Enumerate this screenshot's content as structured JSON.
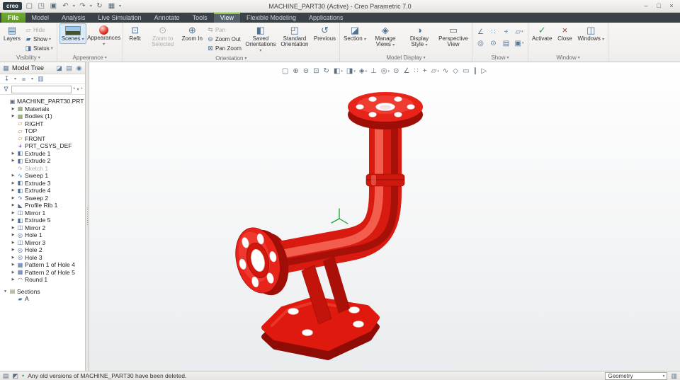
{
  "window": {
    "brand": "creo",
    "title": "MACHINE_PART30 (Active) - Creo Parametric 7.0"
  },
  "colors": {
    "model_red": "#e0190f",
    "model_red_dark": "#8f0c06",
    "tab_bar": "#3a4147",
    "file_tab_green": "#639c30",
    "scenes_selected_blue": "#d9eafb"
  },
  "icons": {
    "chevron_down": "▾",
    "minimize": "–",
    "maximize": "□",
    "close": "×",
    "new_file": "▢",
    "open_file": "◳",
    "save": "▣",
    "undo": "↶",
    "redo": "↷",
    "regenerate": "↻",
    "screen": "▦",
    "qa_more": "▾",
    "layers": "▤",
    "hide": "▱",
    "show": "▰",
    "status": "◨",
    "refit": "⊡",
    "zoom_to_selected": "⊙",
    "zoom_in": "⊕",
    "pan": "⇆",
    "zoom_out": "⊖",
    "pan_zoom": "⊠",
    "saved_orientations": "◧",
    "standard_orientation": "◰",
    "previous": "↺",
    "section": "◪",
    "manage_views": "◈",
    "display_style": "◑",
    "perspective_view": "▭",
    "activate": "✓",
    "close_window": "×",
    "windows": "◫",
    "model_tree": "▦",
    "tree_folders": "◪",
    "tree_save": "▤",
    "info": "◉",
    "tree_filter": "↧",
    "tree_settings": "≡",
    "tree_columns": "▥",
    "search_funnel": "∇",
    "search_clear": "×",
    "search_options": "▾",
    "search_add": "+",
    "msg_log": "▤",
    "msg_flag": "◩",
    "mouse_hint": "▥",
    "bullet": "•"
  },
  "ribbon": {
    "tabs": [
      "File",
      "Model",
      "Analysis",
      "Live Simulation",
      "Annotate",
      "Tools",
      "View",
      "Flexible Modeling",
      "Applications"
    ],
    "active_tab": "View",
    "visibility": {
      "label": "Visibility",
      "layers": "Layers",
      "hide": "Hide",
      "show": "Show",
      "status": "Status"
    },
    "appearance": {
      "label": "Appearance",
      "scenes": "Scenes",
      "appearances": "Appearances"
    },
    "orientation": {
      "label": "Orientation",
      "refit": "Refit",
      "zoom_to_selected": "Zoom to Selected",
      "zoom_in": "Zoom In",
      "pan": "Pan",
      "zoom_out": "Zoom Out",
      "pan_zoom": "Pan Zoom",
      "saved_orientations": "Saved Orientations",
      "standard_orientation": "Standard Orientation",
      "previous": "Previous"
    },
    "model_display": {
      "label": "Model Display",
      "section": "Section",
      "manage_views": "Manage Views",
      "display_style": "Display Style",
      "perspective_view": "Perspective View"
    },
    "show": {
      "label": "Show",
      "icons": [
        {
          "name": "datum-axes-toggle-icon",
          "glyph": "∠"
        },
        {
          "name": "datum-points-toggle-icon",
          "glyph": "∷"
        },
        {
          "name": "datum-csys-toggle-icon",
          "glyph": "+"
        },
        {
          "name": "datum-planes-toggle-icon",
          "glyph": "▱",
          "chev": "▾"
        },
        {
          "name": "annotations-toggle-icon",
          "glyph": "◎"
        },
        {
          "name": "spin-center-toggle-icon",
          "glyph": "⊙"
        },
        {
          "name": "notes-toggle-icon",
          "glyph": "▤"
        },
        {
          "name": "plane-tags-toggle-icon",
          "glyph": "▣",
          "chev": "▾"
        }
      ]
    },
    "window_group": {
      "label": "Window",
      "activate": "Activate",
      "close": "Close",
      "windows": "Windows"
    }
  },
  "graphics_toolbar": {
    "icons": [
      {
        "name": "select-box-icon",
        "glyph": "▢"
      },
      {
        "name": "zoom-in-icon",
        "glyph": "⊕"
      },
      {
        "name": "zoom-out-icon",
        "glyph": "⊖"
      },
      {
        "name": "refit-icon",
        "glyph": "⊡"
      },
      {
        "name": "repaint-icon",
        "glyph": "↻"
      },
      {
        "name": "shading-icon",
        "glyph": "◧",
        "chev": "▾"
      },
      {
        "name": "display-style-icon",
        "glyph": "◨",
        "chev": "▾"
      },
      {
        "name": "saved-views-icon",
        "glyph": "◈",
        "chev": "▾"
      },
      {
        "name": "view-normal-icon",
        "glyph": "⊥"
      },
      {
        "name": "annotations-icon",
        "glyph": "◎",
        "chev": "▾"
      },
      {
        "name": "spin-center-icon",
        "glyph": "⊙"
      },
      {
        "name": "datum-axes-icon",
        "glyph": "∠"
      },
      {
        "name": "datum-points-icon",
        "glyph": "∷"
      },
      {
        "name": "datum-csys-icon",
        "glyph": "+"
      },
      {
        "name": "datum-planes-icon",
        "glyph": "▱",
        "chev": "▾"
      },
      {
        "name": "sketch-display-icon",
        "glyph": "∿"
      },
      {
        "name": "dragger-icon",
        "glyph": "◇"
      },
      {
        "name": "perspective-icon",
        "glyph": "▭"
      },
      {
        "name": "pause-icon",
        "glyph": "∥"
      },
      {
        "name": "play-icon",
        "glyph": "▷"
      }
    ]
  },
  "model_tree": {
    "title": "Model Tree",
    "search_value": "",
    "items": [
      {
        "name": "tree-item-machine-part30",
        "label": "MACHINE_PART30.PRT",
        "level": 0,
        "expander": "",
        "glyph": "▣",
        "cat": "part"
      },
      {
        "name": "tree-item-materials",
        "label": "Materials",
        "level": 1,
        "expander": "▶",
        "glyph": "▦",
        "cat": "folder"
      },
      {
        "name": "tree-item-bodies",
        "label": "Bodies (1)",
        "level": 1,
        "expander": "▶",
        "glyph": "▦",
        "cat": "folder"
      },
      {
        "name": "tree-item-right",
        "label": "RIGHT",
        "level": 1,
        "expander": "",
        "glyph": "▱",
        "cat": "plane"
      },
      {
        "name": "tree-item-top",
        "label": "TOP",
        "level": 1,
        "expander": "",
        "glyph": "▱",
        "cat": "plane"
      },
      {
        "name": "tree-item-front",
        "label": "FRONT",
        "level": 1,
        "expander": "",
        "glyph": "▱",
        "cat": "plane"
      },
      {
        "name": "tree-item-prt-csys-def",
        "label": "PRT_CSYS_DEF",
        "level": 1,
        "expander": "",
        "glyph": "+",
        "cat": "csys"
      },
      {
        "name": "tree-item-extrude-1",
        "label": "Extrude 1",
        "level": 1,
        "expander": "▶",
        "glyph": "◧",
        "cat": "feature"
      },
      {
        "name": "tree-item-extrude-2",
        "label": "Extrude 2",
        "level": 1,
        "expander": "▶",
        "glyph": "◧",
        "cat": "feature"
      },
      {
        "name": "tree-item-sketch-1",
        "label": "Sketch 1",
        "level": 1,
        "expander": "",
        "glyph": "∿",
        "cat": "sketch",
        "dim": true
      },
      {
        "name": "tree-item-sweep-1",
        "label": "Sweep 1",
        "level": 1,
        "expander": "▶",
        "glyph": "∿",
        "cat": "feature"
      },
      {
        "name": "tree-item-extrude-3",
        "label": "Extrude 3",
        "level": 1,
        "expander": "▶",
        "glyph": "◧",
        "cat": "feature"
      },
      {
        "name": "tree-item-extrude-4",
        "label": "Extrude 4",
        "level": 1,
        "expander": "▶",
        "glyph": "◧",
        "cat": "feature"
      },
      {
        "name": "tree-item-sweep-2",
        "label": "Sweep 2",
        "level": 1,
        "expander": "▶",
        "glyph": "∿",
        "cat": "feature"
      },
      {
        "name": "tree-item-profile-rib-1",
        "label": "Profile Rib 1",
        "level": 1,
        "expander": "▶",
        "glyph": "◣",
        "cat": "feature"
      },
      {
        "name": "tree-item-mirror-1",
        "label": "Mirror 1",
        "level": 1,
        "expander": "▶",
        "glyph": "◫",
        "cat": "feature"
      },
      {
        "name": "tree-item-extrude-5",
        "label": "Extrude 5",
        "level": 1,
        "expander": "▶",
        "glyph": "◧",
        "cat": "feature"
      },
      {
        "name": "tree-item-mirror-2",
        "label": "Mirror 2",
        "level": 1,
        "expander": "▶",
        "glyph": "◫",
        "cat": "feature"
      },
      {
        "name": "tree-item-hole-1",
        "label": "Hole 1",
        "level": 1,
        "expander": "▶",
        "glyph": "◎",
        "cat": "feature"
      },
      {
        "name": "tree-item-mirror-3",
        "label": "Mirror 3",
        "level": 1,
        "expander": "▶",
        "glyph": "◫",
        "cat": "feature"
      },
      {
        "name": "tree-item-hole-2",
        "label": "Hole 2",
        "level": 1,
        "expander": "▶",
        "glyph": "◎",
        "cat": "feature"
      },
      {
        "name": "tree-item-hole-3",
        "label": "Hole 3",
        "level": 1,
        "expander": "▶",
        "glyph": "◎",
        "cat": "feature"
      },
      {
        "name": "tree-item-pattern-1-of-hole-4",
        "label": "Pattern 1 of Hole 4",
        "level": 1,
        "expander": "▶",
        "glyph": "▦",
        "cat": "feature"
      },
      {
        "name": "tree-item-pattern-2-of-hole-5",
        "label": "Pattern 2 of Hole 5",
        "level": 1,
        "expander": "▶",
        "glyph": "▦",
        "cat": "feature"
      },
      {
        "name": "tree-item-round-1",
        "label": "Round 1",
        "level": 1,
        "expander": "▶",
        "glyph": "◠",
        "cat": "feature"
      },
      {
        "name": "tree-item-sections",
        "label": "Sections",
        "level": 0,
        "expander": "▼",
        "glyph": "▤",
        "cat": "folder",
        "space": true
      },
      {
        "name": "tree-item-section-a",
        "label": "A",
        "level": 1,
        "expander": "",
        "glyph": "▰",
        "cat": "section"
      }
    ]
  },
  "status_bar": {
    "message": "Any old versions of MACHINE_PART30 have been deleted.",
    "selector": "Geometry"
  }
}
